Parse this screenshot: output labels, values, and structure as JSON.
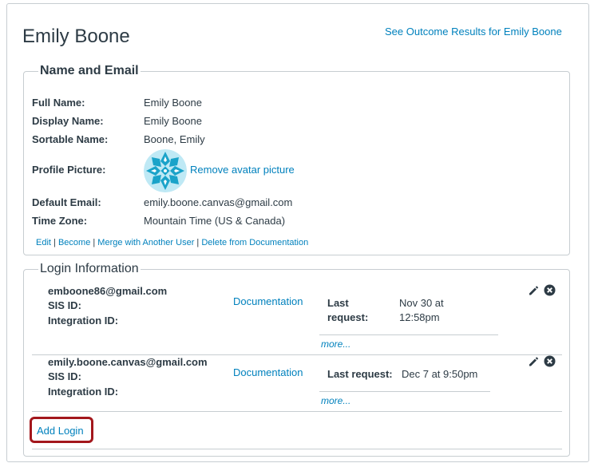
{
  "user": {
    "name": "Emily Boone",
    "outcome_link": "See Outcome Results for Emily Boone"
  },
  "name_email": {
    "legend": "Name and Email",
    "rows": [
      {
        "label": "Full Name:",
        "value": "Emily Boone"
      },
      {
        "label": "Display Name:",
        "value": "Emily Boone"
      },
      {
        "label": "Sortable Name:",
        "value": "Boone, Emily"
      },
      {
        "label": "Profile Picture:",
        "value": ""
      },
      {
        "label": "Default Email:",
        "value": "emily.boone.canvas@gmail.com"
      },
      {
        "label": "Time Zone:",
        "value": "Mountain Time (US & Canada)"
      }
    ],
    "remove_avatar": "Remove avatar picture",
    "actions": [
      "Edit",
      "Become",
      "Merge with Another User",
      "Delete from Documentation"
    ],
    "separator": " | "
  },
  "login_info": {
    "legend": "Login Information",
    "logins": [
      {
        "id": "emboone86@gmail.com",
        "sis_label": "SIS ID:",
        "integration_label": "Integration ID:",
        "provider": "Documentation",
        "last_request_label_1": "Last",
        "last_request_label_2": "request:",
        "last_request_value_1": "Nov 30 at",
        "last_request_value_2": "12:58pm",
        "more": "more..."
      },
      {
        "id": "emily.boone.canvas@gmail.com",
        "sis_label": "SIS ID:",
        "integration_label": "Integration ID:",
        "provider": "Documentation",
        "last_request_label": "Last request:",
        "last_request_value": "Dec 7 at 9:50pm",
        "more": "more..."
      }
    ],
    "add_login": "Add Login"
  },
  "colors": {
    "link": "#0081bd",
    "text": "#2d3b45",
    "border": "#c7cdd1",
    "highlight": "#a3171c",
    "avatar_primary": "#1aa3c9",
    "avatar_light": "#bfe9f5"
  }
}
